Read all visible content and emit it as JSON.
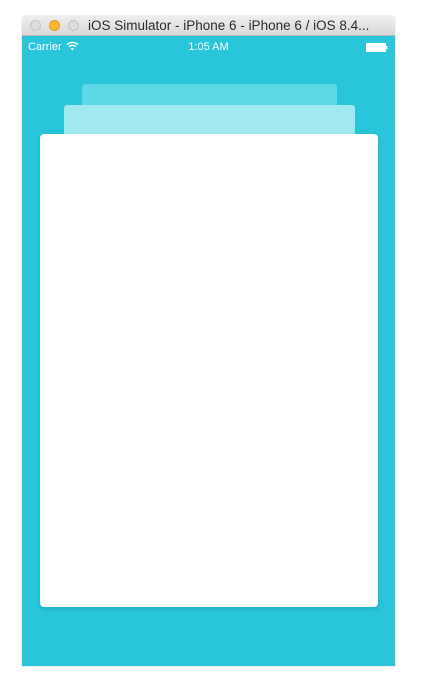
{
  "window": {
    "title": "iOS Simulator - iPhone 6 - iPhone 6 / iOS 8.4..."
  },
  "status_bar": {
    "carrier": "Carrier",
    "time": "1:05 AM",
    "icons": [
      "wifi-icon",
      "battery-icon"
    ]
  },
  "colors": {
    "background": "#29c5db",
    "stack_back": "#5ed7e6",
    "stack_middle": "#a1e9f1",
    "card": "#ffffff",
    "minimize_button": "#fcb731"
  },
  "cards": {
    "stack_count": 3
  }
}
